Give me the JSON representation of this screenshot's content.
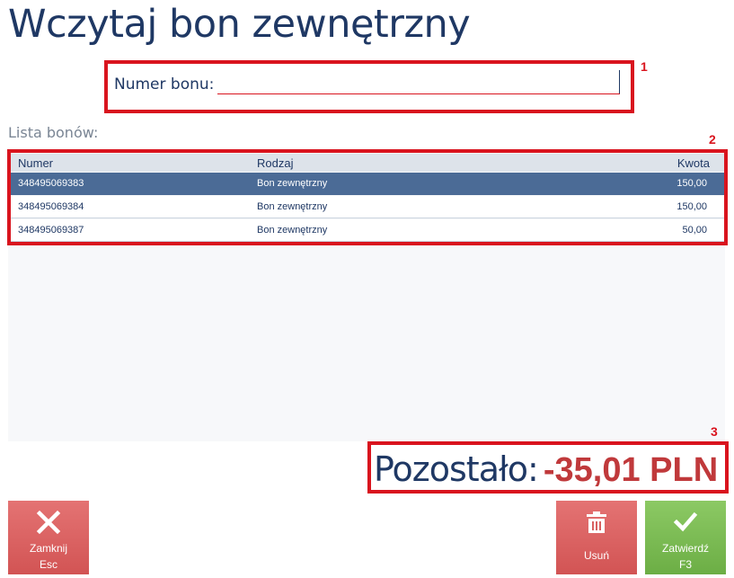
{
  "header": {
    "title": "Wczytaj bon zewnętrzny"
  },
  "voucher_input": {
    "label": "Numer bonu:",
    "value": "",
    "placeholder": ""
  },
  "list": {
    "label": "Lista bonów:",
    "columns": {
      "number": "Numer",
      "type": "Rodzaj",
      "amount": "Kwota"
    },
    "rows": [
      {
        "number": "348495069383",
        "type": "Bon zewnętrzny",
        "amount": "150,00",
        "selected": true
      },
      {
        "number": "348495069384",
        "type": "Bon zewnętrzny",
        "amount": "150,00",
        "selected": false
      },
      {
        "number": "348495069387",
        "type": "Bon zewnętrzny",
        "amount": "50,00",
        "selected": false
      }
    ]
  },
  "summary": {
    "remaining_label": "Pozostało:",
    "remaining_value": "-35,01 PLN"
  },
  "callouts": {
    "one": "1",
    "two": "2",
    "three": "3"
  },
  "buttons": {
    "close": {
      "label": "Zamknij",
      "shortcut": "Esc",
      "icon": "close-icon"
    },
    "delete": {
      "label": "Usuń",
      "icon": "trash-icon"
    },
    "confirm": {
      "label": "Zatwierdź",
      "shortcut": "F3",
      "icon": "check-icon"
    }
  },
  "colors": {
    "title": "#1f3864",
    "callout": "#d9141e",
    "selected_row": "#4b6b96",
    "remaining_value": "#c0393b",
    "danger_button": "#d25454",
    "confirm_button": "#6cae45"
  }
}
